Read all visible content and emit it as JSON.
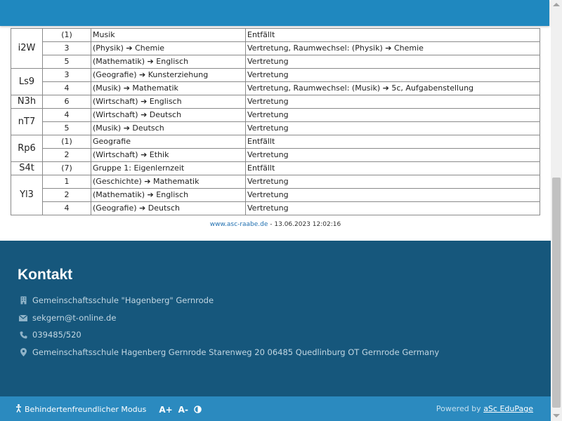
{
  "table": {
    "rows": [
      {
        "class": "i2W",
        "period": "(1)",
        "subject": "Musik",
        "info": "Entfällt"
      },
      {
        "class": "",
        "period": "3",
        "subject": "(Physik) ➔ Chemie",
        "info": "Vertretung, Raumwechsel: (Physik) ➔ Chemie"
      },
      {
        "class": "",
        "period": "5",
        "subject": "(Mathematik) ➔ Englisch",
        "info": "Vertretung"
      },
      {
        "class": "Ls9",
        "period": "3",
        "subject": "(Geografie) ➔ Kunsterziehung",
        "info": "Vertretung"
      },
      {
        "class": "",
        "period": "4",
        "subject": "(Musik) ➔ Mathematik",
        "info": "Vertretung, Raumwechsel: (Musik) ➔ 5c, Aufgabenstellung"
      },
      {
        "class": "N3h",
        "period": "6",
        "subject": "(Wirtschaft) ➔ Englisch",
        "info": "Vertretung"
      },
      {
        "class": "nT7",
        "period": "4",
        "subject": "(Wirtschaft) ➔ Deutsch",
        "info": "Vertretung"
      },
      {
        "class": "",
        "period": "5",
        "subject": "(Musik) ➔ Deutsch",
        "info": "Vertretung"
      },
      {
        "class": "Rp6",
        "period": "(1)",
        "subject": "Geografie",
        "info": "Entfällt"
      },
      {
        "class": "",
        "period": "2",
        "subject": "(Wirtschaft) ➔ Ethik",
        "info": "Vertretung"
      },
      {
        "class": "S4t",
        "period": "(7)",
        "subject": "Gruppe 1: Eigenlernzeit",
        "info": "Entfällt"
      },
      {
        "class": "Yl3",
        "period": "1",
        "subject": "(Geschichte) ➔ Mathematik",
        "info": "Vertretung"
      },
      {
        "class": "",
        "period": "2",
        "subject": "(Mathematik) ➔ Englisch",
        "info": "Vertretung"
      },
      {
        "class": "",
        "period": "4",
        "subject": "(Geografie) ➔ Deutsch",
        "info": "Vertretung"
      }
    ],
    "groups": [
      {
        "label": "i2W",
        "span": 3
      },
      {
        "label": "Ls9",
        "span": 2
      },
      {
        "label": "N3h",
        "span": 1
      },
      {
        "label": "nT7",
        "span": 2
      },
      {
        "label": "Rp6",
        "span": 2
      },
      {
        "label": "S4t",
        "span": 1
      },
      {
        "label": "Yl3",
        "span": 3
      }
    ]
  },
  "source": {
    "link": "www.asc-raabe.de",
    "timestamp": " - 13.06.2023 12:02:16"
  },
  "footer": {
    "title": "Kontakt",
    "contacts": [
      {
        "icon": "building-icon",
        "text": "Gemeinschaftsschule \"Hagenberg\" Gernrode"
      },
      {
        "icon": "envelope-icon",
        "text": "sekgern@t-online.de"
      },
      {
        "icon": "phone-icon",
        "text": "039485/520"
      },
      {
        "icon": "location-pin-icon",
        "text": "Gemeinschaftsschule Hagenberg Gernrode Starenweg 20 06485 Quedlinburg OT Gernrode Germany"
      }
    ]
  },
  "bottombar": {
    "accessibility_label": "Behindertenfreundlicher Modus",
    "font_increase": "A+",
    "font_decrease": "A-",
    "contrast_icon": "contrast-icon",
    "powered_by": "Powered by ",
    "brand": "aSc EduPage"
  },
  "colors": {
    "topbar": "#1f88bf",
    "footer": "#16577c",
    "bottombar": "#2b8abf"
  }
}
